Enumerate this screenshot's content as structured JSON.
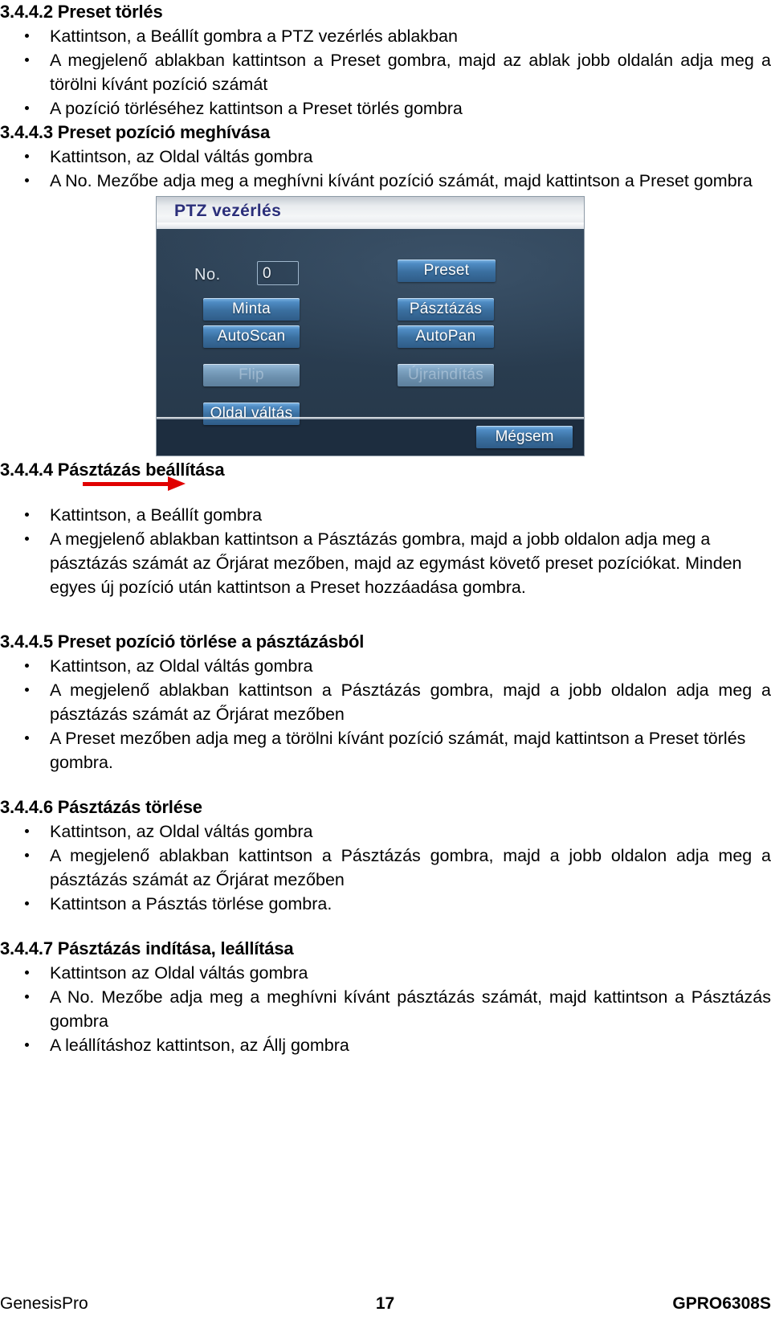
{
  "document": {
    "language": "hu",
    "sections": [
      {
        "id": "3.4.4.2",
        "heading": "3.4.4.2 Preset törlés",
        "bullets": [
          "Kattintson, a Beállít gombra a PTZ vezérlés ablakban",
          "A megjelenő ablakban kattintson a Preset gombra, majd az ablak jobb oldalán adja meg a törölni kívánt pozíció számát",
          "A pozíció törléséhez kattintson a Preset törlés gombra"
        ]
      },
      {
        "id": "3.4.4.3",
        "heading": "3.4.4.3 Preset pozíció meghívása",
        "bullets": [
          "Kattintson, az Oldal váltás gombra",
          "A No. Mezőbe adja meg a meghívni kívánt pozíció számát, majd kattintson a Preset gombra"
        ]
      },
      {
        "id": "3.4.4.4",
        "heading": "3.4.4.4 Pásztázás beállítása",
        "bullets": [
          "Kattintson, a Beállít gombra",
          "A megjelenő ablakban kattintson a Pásztázás gombra, majd a jobb oldalon adja meg a pásztázás számát az Őrjárat mezőben, majd az egymást követő preset pozíciókat. Minden egyes új pozíció után kattintson a Preset hozzáadása gombra."
        ]
      },
      {
        "id": "3.4.4.5",
        "heading": "3.4.4.5 Preset pozíció törlése a pásztázásból",
        "bullets": [
          "Kattintson, az Oldal váltás gombra",
          "A megjelenő ablakban kattintson a Pásztázás gombra, majd a jobb oldalon adja meg a pásztázás számát az Őrjárat mezőben",
          "A Preset mezőben adja meg a törölni kívánt pozíció számát, majd kattintson a Preset törlés gombra."
        ]
      },
      {
        "id": "3.4.4.6",
        "heading": "3.4.4.6 Pásztázás törlése",
        "bullets": [
          "Kattintson, az Oldal váltás gombra",
          "A megjelenő ablakban kattintson a Pásztázás gombra, majd a jobb oldalon adja meg a pásztázás számát az Őrjárat mezőben",
          "Kattintson a Pásztás törlése gombra."
        ]
      },
      {
        "id": "3.4.4.7",
        "heading": "3.4.4.7 Pásztázás indítása, leállítása",
        "bullets": [
          "Kattintson az Oldal váltás gombra",
          "A No. Mezőbe adja meg a meghívni kívánt pásztázás számát, majd kattintson a Pásztázás gombra",
          "A leállításhoz kattintson, az Állj gombra"
        ]
      }
    ]
  },
  "figure": {
    "annotation": "red-arrow-pointing-to-no-field",
    "dialog": {
      "title": "PTZ vezérlés",
      "no_label": "No.",
      "no_value": "0",
      "buttons": {
        "preset": "Preset",
        "minta": "Minta",
        "pasztazas": "Pásztázás",
        "autoscan": "AutoScan",
        "autopan": "AutoPan",
        "flip": "Flip",
        "ujrainditas": "Újraindítás",
        "oldal_valtas": "Oldal váltás",
        "megsem": "Mégsem"
      },
      "disabled_buttons": [
        "flip",
        "ujrainditas"
      ],
      "colors": {
        "titlebar": "#eef1f3",
        "title_text": "#2b2f7a",
        "body": "#2b3f53",
        "button": "#3a6f9f",
        "button_text": "#ffffff",
        "arrow": "#e00000"
      }
    }
  },
  "footer": {
    "left": "GenesisPro",
    "center": "17",
    "right": "GPRO6308S"
  }
}
